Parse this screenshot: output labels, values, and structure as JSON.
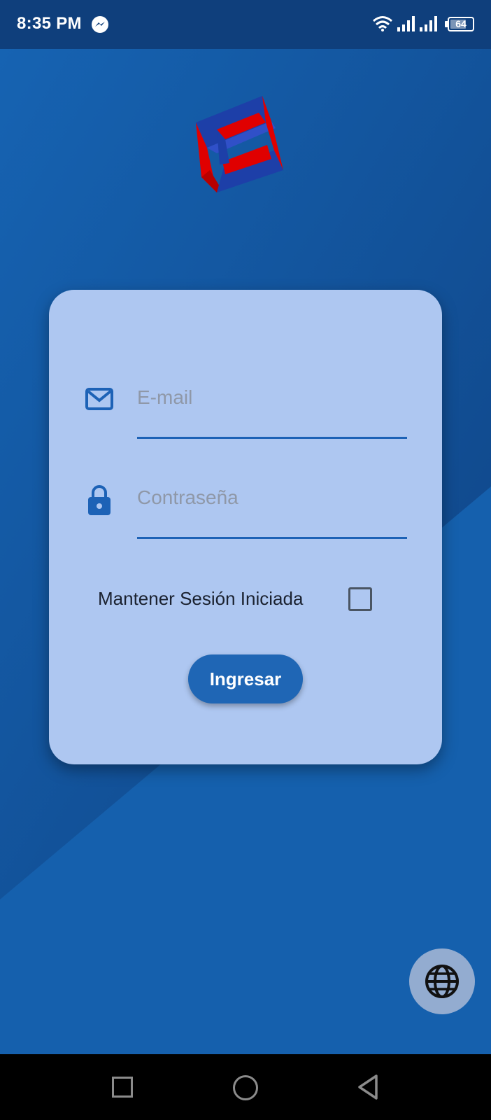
{
  "status_bar": {
    "time": "8:35 PM",
    "battery_level": "64",
    "icons": [
      "messenger-icon",
      "wifi-icon",
      "signal-icon",
      "signal-icon",
      "battery-icon"
    ]
  },
  "logo": {
    "icon": "app-logo-icon",
    "colors": {
      "red": "#e00000",
      "blue": "#1d3fa8"
    }
  },
  "login_form": {
    "email": {
      "placeholder": "E-mail",
      "value": "",
      "icon": "mail-icon"
    },
    "password": {
      "placeholder": "Contraseña",
      "value": "",
      "icon": "lock-icon"
    },
    "remember": {
      "label": "Mantener Sesión Iniciada",
      "checked": false
    },
    "submit_label": "Ingresar"
  },
  "language_button": {
    "icon": "globe-icon"
  },
  "nav_bar": {
    "icons": [
      "recents-icon",
      "home-icon",
      "back-icon"
    ]
  },
  "colors": {
    "background": "#1560ad",
    "background_dark": "#0f4386",
    "status_bar": "#0f3f7c",
    "card": "#aec7f1",
    "accent": "#1f66b5"
  }
}
